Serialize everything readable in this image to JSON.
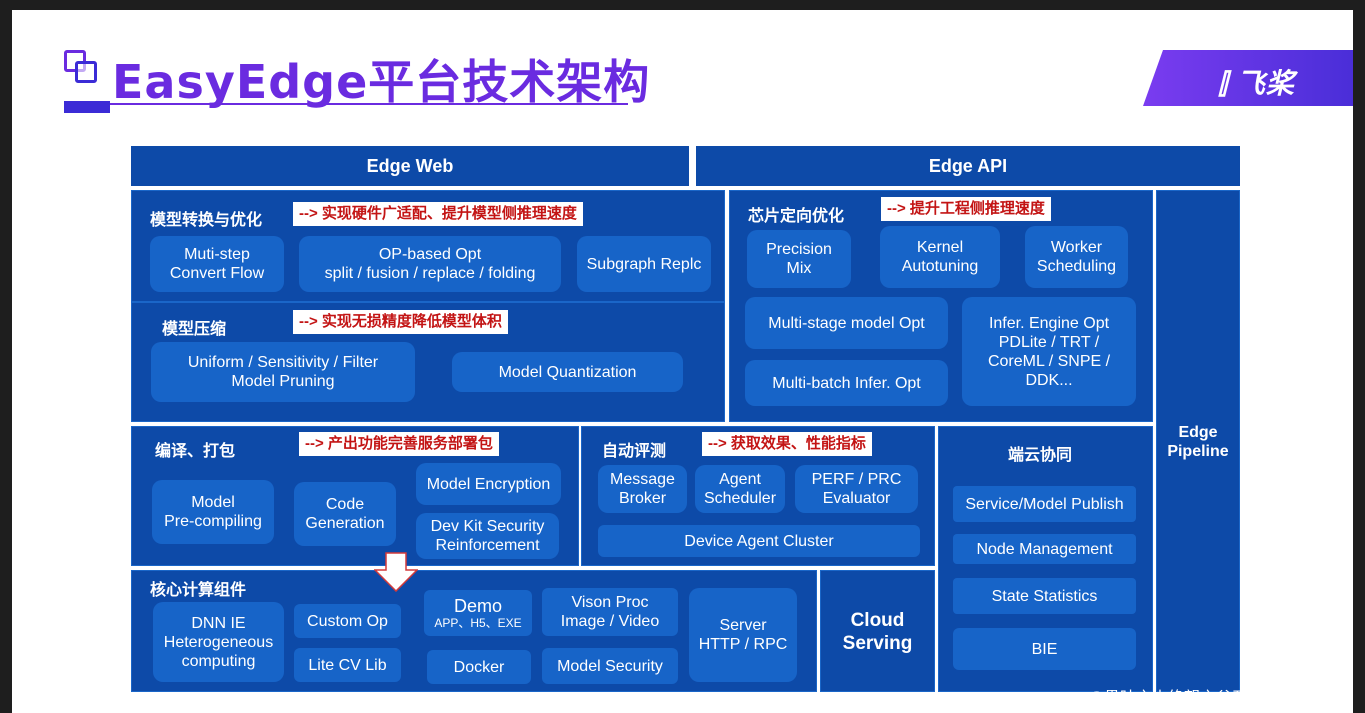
{
  "title": "EasyEdge平台技术架构",
  "brand": "飞桨",
  "watermark": "CSDN @愚昧之山绝望之谷开悟之坡",
  "edge_web": "Edge Web",
  "edge_api": "Edge API",
  "edge_pipeline": [
    "Edge",
    "Pipeline"
  ],
  "model_convert": {
    "label": "模型转换与优化",
    "note": "--> 实现硬件广适配、提升模型侧推理速度",
    "items": [
      [
        "Muti-step",
        "Convert Flow"
      ],
      [
        "OP-based Opt",
        "split / fusion / replace / folding"
      ],
      [
        "Subgraph Replc"
      ]
    ]
  },
  "model_compress": {
    "label": "模型压缩",
    "note": "--> 实现无损精度降低模型体积",
    "items": [
      [
        "Uniform / Sensitivity / Filter",
        "Model Pruning"
      ],
      [
        "Model Quantization"
      ]
    ]
  },
  "chip_opt": {
    "label": "芯片定向优化",
    "note": "--> 提升工程侧推理速度",
    "items": [
      [
        "Precision",
        "Mix"
      ],
      [
        "Kernel",
        "Autotuning"
      ],
      [
        "Worker",
        "Scheduling"
      ],
      [
        "Multi-stage model Opt"
      ],
      [
        "Multi-batch Infer. Opt"
      ],
      [
        "Infer. Engine Opt",
        "PDLite / TRT /",
        "CoreML / SNPE /",
        "DDK..."
      ]
    ]
  },
  "compile_pack": {
    "label": "编译、打包",
    "note": "--> 产出功能完善服务部署包",
    "items": [
      [
        "Model",
        "Pre-compiling"
      ],
      [
        "Code",
        "Generation"
      ],
      [
        "Model Encryption"
      ],
      [
        "Dev Kit Security",
        "Reinforcement"
      ]
    ]
  },
  "auto_eval": {
    "label": "自动评测",
    "note": "--> 获取效果、性能指标",
    "items": [
      [
        "Message",
        "Broker"
      ],
      [
        "Agent",
        "Scheduler"
      ],
      [
        "PERF / PRC",
        "Evaluator"
      ],
      [
        "Device Agent Cluster"
      ]
    ]
  },
  "edge_cloud": {
    "label": "端云协同",
    "items": [
      "Service/Model  Publish",
      "Node Management",
      "State Statistics",
      "BIE"
    ]
  },
  "core_compute": {
    "label": "核心计算组件",
    "items": [
      [
        "DNN IE",
        "Heterogeneous",
        "computing"
      ],
      [
        "Custom Op"
      ],
      [
        "Lite CV Lib"
      ],
      [
        "Demo",
        "APP、H5、EXE"
      ],
      [
        "Docker"
      ],
      [
        "Vison Proc",
        "Image / Video"
      ],
      [
        "Model Security"
      ],
      [
        "Server",
        "HTTP / RPC"
      ]
    ]
  },
  "cloud_serving": [
    "Cloud",
    "Serving"
  ],
  "colors": {
    "title": "#6a2be0",
    "panel": "#0d4aa8",
    "box": "#1764c8",
    "note_text": "#c31414"
  }
}
